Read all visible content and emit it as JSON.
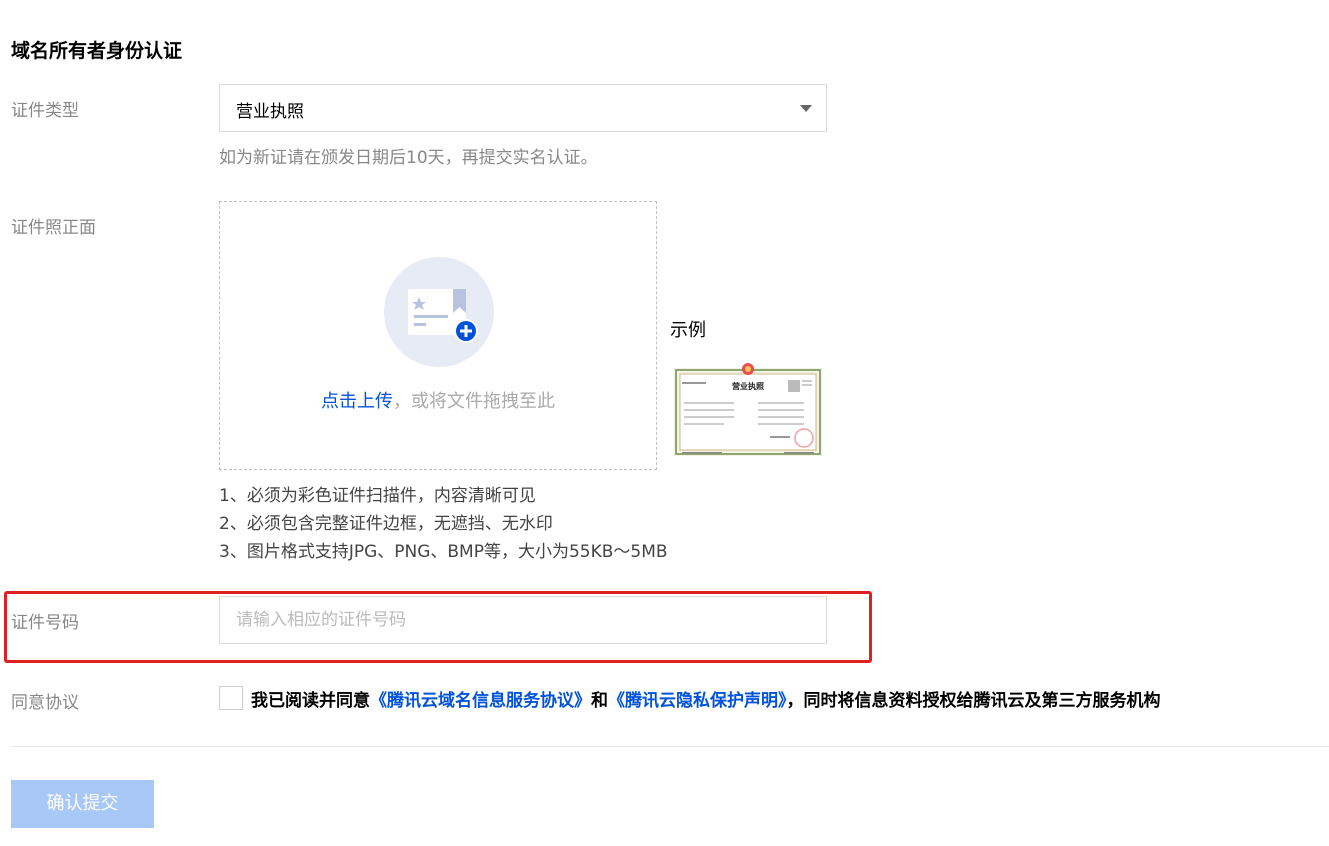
{
  "section": {
    "title": "域名所有者身份认证"
  },
  "id_type": {
    "label": "证件类型",
    "selected": "营业执照",
    "hint": "如为新证请在颁发日期后10天，再提交实名认证。"
  },
  "id_photo": {
    "label": "证件照正面",
    "upload_link": "点击上传",
    "upload_text": "，或将文件拖拽至此",
    "example_label": "示例",
    "example_image_title": "营业执照",
    "rules": [
      "1、必须为彩色证件扫描件，内容清晰可见",
      "2、必须包含完整证件边框，无遮挡、无水印",
      "3、图片格式支持JPG、PNG、BMP等，大小为55KB～5MB"
    ]
  },
  "id_number": {
    "label": "证件号码",
    "placeholder": "请输入相应的证件号码",
    "value": ""
  },
  "agreement": {
    "label": "同意协议",
    "prefix": "我已阅读并同意",
    "link1": "《腾讯云域名信息服务协议》",
    "middle": "和",
    "link2": "《腾讯云隐私保护声明》",
    "suffix": "，同时将信息资料授权给腾讯云及第三方服务机构"
  },
  "submit": {
    "label": "确认提交"
  },
  "colors": {
    "accent": "#0052d9",
    "highlight": "#e02020",
    "submit_disabled": "#a8c8f8"
  },
  "icons": {
    "upload": "certificate-upload-icon",
    "dropdown": "caret-down-icon"
  }
}
